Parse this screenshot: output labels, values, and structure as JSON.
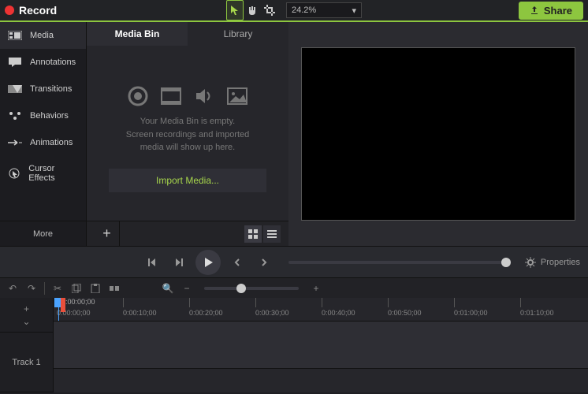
{
  "topbar": {
    "record_label": "Record",
    "zoom_value": "24.2%",
    "share_label": "Share"
  },
  "sidebar": {
    "items": [
      {
        "label": "Media"
      },
      {
        "label": "Annotations"
      },
      {
        "label": "Transitions"
      },
      {
        "label": "Behaviors"
      },
      {
        "label": "Animations"
      },
      {
        "label": "Cursor Effects"
      }
    ],
    "more_label": "More"
  },
  "mediapanel": {
    "tabs": [
      {
        "label": "Media Bin"
      },
      {
        "label": "Library"
      }
    ],
    "empty_line1": "Your Media Bin is empty.",
    "empty_line2": "Screen recordings and imported",
    "empty_line3": "media will show up here.",
    "import_label": "Import Media..."
  },
  "playback": {
    "properties_label": "Properties"
  },
  "timeline": {
    "current_time": "0:00:00;00",
    "track1_label": "Track 1",
    "ticks": [
      {
        "label": "0:00:00;00",
        "pos": 6
      },
      {
        "label": "0:00:10;00",
        "pos": 90
      },
      {
        "label": "0:00:20;00",
        "pos": 174
      },
      {
        "label": "0:00:30;00",
        "pos": 258
      },
      {
        "label": "0:00:40;00",
        "pos": 342
      },
      {
        "label": "0:00:50;00",
        "pos": 426
      },
      {
        "label": "0:01:00;00",
        "pos": 510
      },
      {
        "label": "0:01:10;00",
        "pos": 594
      }
    ]
  }
}
